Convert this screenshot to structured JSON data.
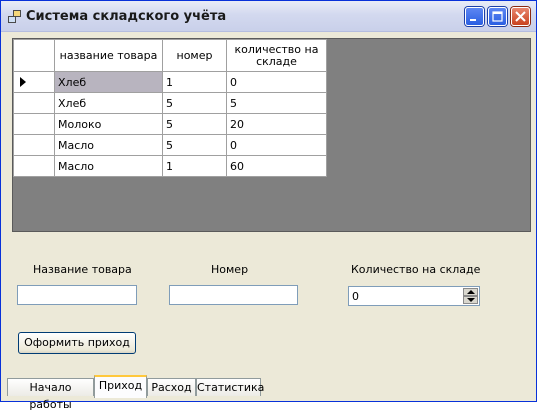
{
  "window": {
    "title": "Система складского учёта"
  },
  "grid": {
    "columns": [
      "название товара",
      "номер",
      "количество на складе"
    ],
    "rows": [
      {
        "current": true,
        "cells": [
          "Хлеб",
          "1",
          "0"
        ]
      },
      {
        "current": false,
        "cells": [
          "Хлеб",
          "5",
          "5"
        ]
      },
      {
        "current": false,
        "cells": [
          "Молоко",
          "5",
          "20"
        ]
      },
      {
        "current": false,
        "cells": [
          "Масло",
          "5",
          "0"
        ]
      },
      {
        "current": false,
        "cells": [
          "Масло",
          "1",
          "60"
        ]
      }
    ]
  },
  "form": {
    "name_label": "Название товара",
    "name_value": "",
    "number_label": "Номер",
    "number_value": "",
    "quantity_label": "Количество на складе",
    "quantity_value": "0",
    "submit_label": "Оформить приход"
  },
  "tabs": [
    {
      "label": "Начало работы",
      "active": false
    },
    {
      "label": "Приход",
      "active": true
    },
    {
      "label": "Расход",
      "active": false
    },
    {
      "label": "Статистика",
      "active": false
    }
  ],
  "icons": {
    "app": "app-icon",
    "minimize": "minimize-icon",
    "maximize": "maximize-icon",
    "close": "close-icon",
    "row_pointer": "row-pointer-icon",
    "spin_up": "chevron-up-icon",
    "spin_down": "chevron-down-icon"
  }
}
